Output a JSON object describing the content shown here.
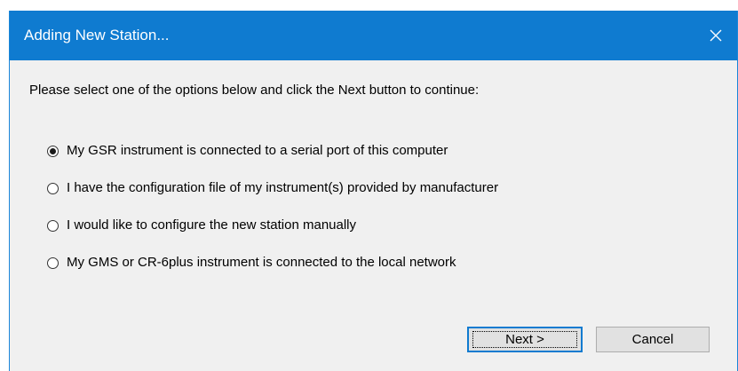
{
  "window": {
    "title": "Adding New Station...",
    "close_icon": "close-icon"
  },
  "instruction": "Please select one of the options below and click the Next button to continue:",
  "options": [
    {
      "label": "My GSR instrument is connected to a serial port of this computer",
      "selected": true
    },
    {
      "label": "I have the configuration file of my instrument(s) provided by manufacturer",
      "selected": false
    },
    {
      "label": "I would like to configure the new station manually",
      "selected": false
    },
    {
      "label": "My GMS or CR-6plus instrument is connected to the local network",
      "selected": false
    }
  ],
  "buttons": {
    "next_label": "Next >",
    "cancel_label": "Cancel"
  },
  "colors": {
    "titlebar": "#0f7bd0",
    "dialog_background": "#f0f0f0",
    "button_background": "#e1e1e1"
  }
}
